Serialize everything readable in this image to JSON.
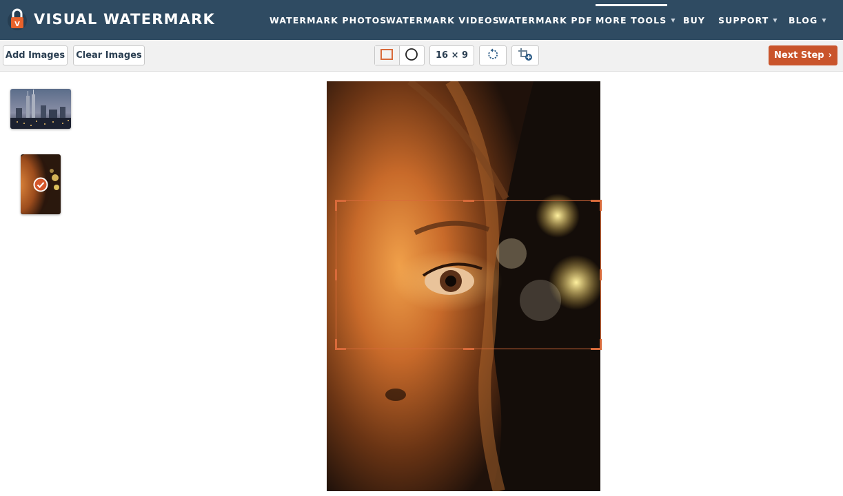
{
  "brand": {
    "name": "VISUAL WATERMARK",
    "logo_letter": "V",
    "logo_color": "#e8622b"
  },
  "nav": {
    "items": [
      {
        "label": "WATERMARK PHOTOS",
        "dropdown": false
      },
      {
        "label": "WATERMARK VIDEOS",
        "dropdown": false
      },
      {
        "label": "WATERMARK PDF",
        "dropdown": false
      },
      {
        "label": "MORE TOOLS",
        "dropdown": true,
        "active": true
      },
      {
        "label": "BUY",
        "dropdown": false
      },
      {
        "label": "SUPPORT",
        "dropdown": true
      },
      {
        "label": "BLOG",
        "dropdown": true
      }
    ],
    "caret": "▼"
  },
  "toolbar": {
    "add_images_label": "Add Images",
    "clear_images_label": "Clear Images",
    "shape_options": [
      "rectangle",
      "circle"
    ],
    "selected_shape": "rectangle",
    "aspect_ratio_label": "16 × 9",
    "next_step_label": "Next Step",
    "next_chevron": "›"
  },
  "sidebar": {
    "thumbnails": [
      {
        "name": "city-skyline-thumbnail",
        "selected": false
      },
      {
        "name": "portrait-thumbnail",
        "selected": true
      }
    ]
  },
  "colors": {
    "header_bg": "#2f4b62",
    "accent": "#c9542b",
    "crop_border": "#d86a3a",
    "toolbar_bg": "#f1f1f1"
  }
}
